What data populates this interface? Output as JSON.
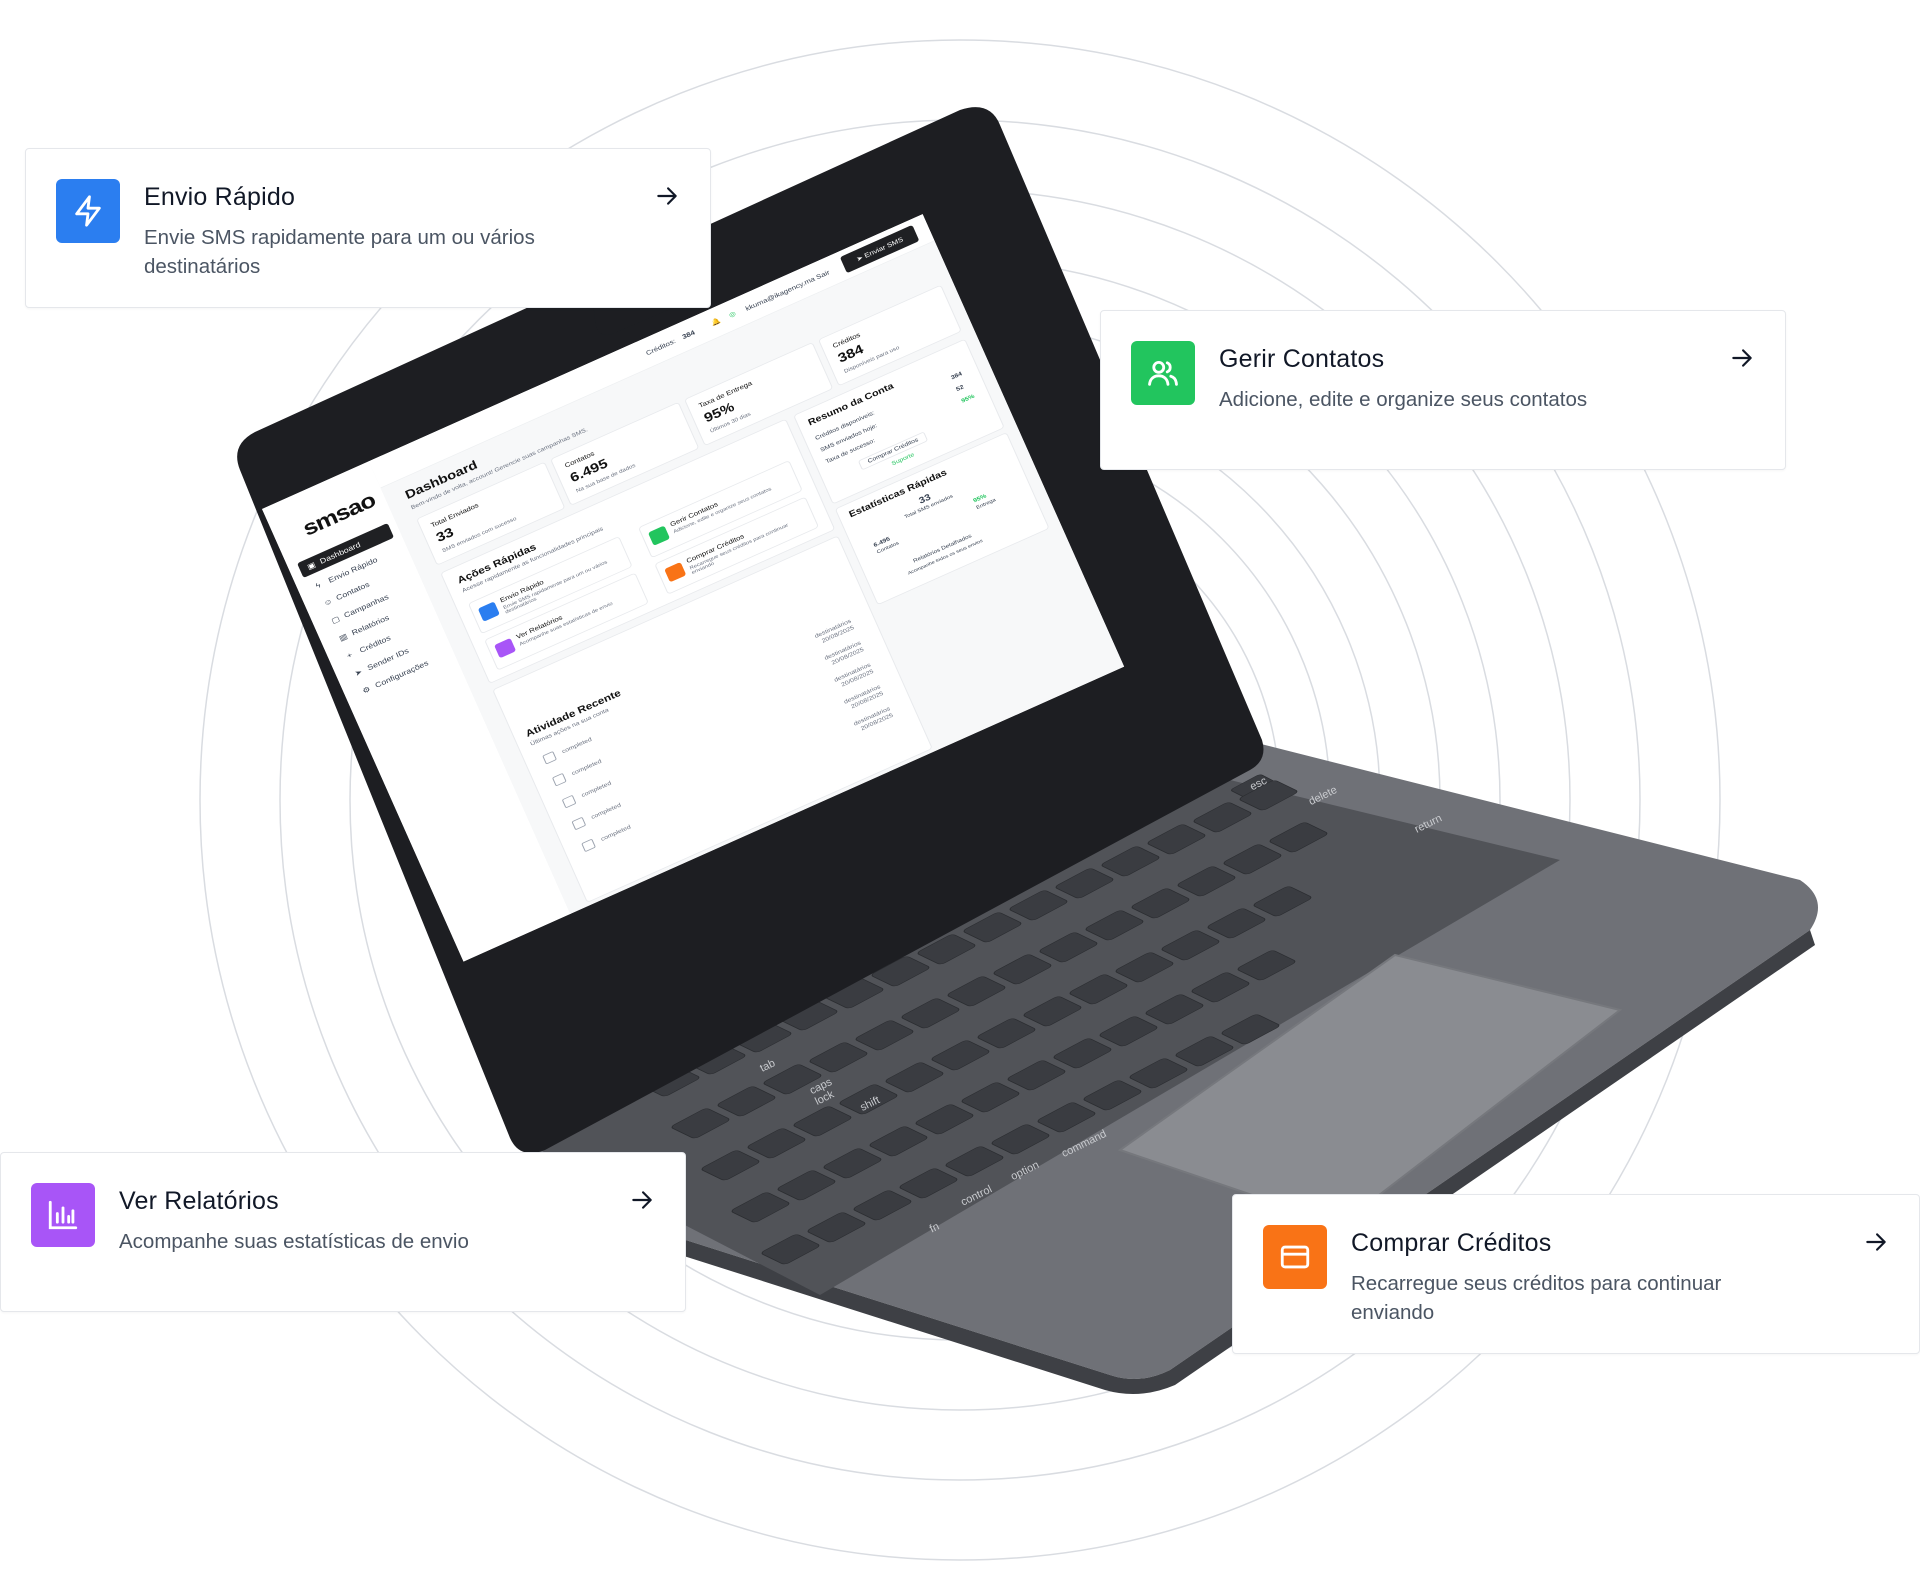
{
  "cards": {
    "envio_rapido": {
      "title": "Envio Rápido",
      "description": "Envie SMS rapidamente para um ou vários destinatários",
      "icon": "lightning-icon",
      "color": "#2b7ef0"
    },
    "gerir_contatos": {
      "title": "Gerir Contatos",
      "description": "Adicione, edite e organize seus contatos",
      "icon": "users-icon",
      "color": "#22c55e"
    },
    "ver_relatorios": {
      "title": "Ver Relatórios",
      "description": "Acompanhe suas estatísticas de envio",
      "icon": "bar-chart-icon",
      "color": "#a855f7"
    },
    "comprar_creditos": {
      "title": "Comprar Créditos",
      "description": "Recarregue seus créditos para continuar enviando",
      "icon": "credit-card-icon",
      "color": "#f97316"
    }
  },
  "dashboard": {
    "logo": "smsao",
    "header": {
      "credits_label": "Créditos:",
      "credits_value": "384",
      "user_email": "kkuma@ikagency.ma",
      "logout": "Sair",
      "send_button": "Enviar SMS"
    },
    "sidebar": [
      {
        "label": "Dashboard",
        "icon": "layout-icon"
      },
      {
        "label": "Envio Rápido",
        "icon": "lightning-icon"
      },
      {
        "label": "Contatos",
        "icon": "users-icon"
      },
      {
        "label": "Campanhas",
        "icon": "calendar-icon"
      },
      {
        "label": "Relatórios",
        "icon": "bar-chart-icon"
      },
      {
        "label": "Créditos",
        "icon": "plus-icon"
      },
      {
        "label": "Sender IDs",
        "icon": "send-icon"
      },
      {
        "label": "Configurações",
        "icon": "gear-icon"
      }
    ],
    "page_title": "Dashboard",
    "page_subtitle": "Bem-vindo de volta, account! Gerencie suas campanhas SMS.",
    "stats": [
      {
        "label": "Total Enviados",
        "value": "33",
        "sub": "SMS enviados com sucesso"
      },
      {
        "label": "Contatos",
        "value": "6.495",
        "sub": "Na sua base de dados"
      },
      {
        "label": "Taxa de Entrega",
        "value": "95%",
        "sub": "Últimos 30 dias"
      },
      {
        "label": "Créditos",
        "value": "384",
        "sub": "Disponíveis para uso"
      }
    ],
    "quick_actions": {
      "title": "Ações Rápidas",
      "subtitle": "Acesse rapidamente as funcionalidades principais",
      "items": [
        {
          "title": "Envio Rápido",
          "desc": "Envie SMS rapidamente para um ou vários destinatários"
        },
        {
          "title": "Gerir Contatos",
          "desc": "Adicione, edite e organize seus contatos"
        },
        {
          "title": "Ver Relatórios",
          "desc": "Acompanhe suas estatísticas de envio"
        },
        {
          "title": "Comprar Créditos",
          "desc": "Recarregue seus créditos para continuar enviando"
        }
      ]
    },
    "account_summary": {
      "title": "Resumo da Conta",
      "rows": [
        {
          "label": "Créditos disponíveis:",
          "value": "384"
        },
        {
          "label": "SMS enviados hoje:",
          "value": "52"
        },
        {
          "label": "Taxa de sucesso:",
          "value": "95%"
        }
      ],
      "buy_button": "Comprar Créditos",
      "support_link": "Suporte"
    },
    "quick_stats": {
      "title": "Estatísticas Rápidas",
      "total_value": "33",
      "total_label": "Total SMS enviados",
      "contacts_value": "6.495",
      "contacts_label": "Contatos",
      "delivery_value": "95%",
      "delivery_label": "Entrega",
      "report_title": "Relatórios Detalhados",
      "report_desc": "Acompanhe todos os seus envios"
    },
    "recent_activity": {
      "title": "Atividade Recente",
      "subtitle": "Últimas ações na sua conta",
      "items": [
        {
          "status": "completed",
          "who": "destinatários",
          "date": "20/08/2025"
        },
        {
          "status": "completed",
          "who": "destinatários",
          "date": "20/08/2025"
        },
        {
          "status": "completed",
          "who": "destinatários",
          "date": "20/08/2025"
        },
        {
          "status": "completed",
          "who": "destinatários",
          "date": "20/08/2025"
        },
        {
          "status": "completed",
          "who": "destinatários",
          "date": "20/08/2025"
        }
      ]
    }
  },
  "keyboard_labels": [
    "esc",
    "delete",
    "return",
    "shift",
    "tab",
    "caps lock",
    "control",
    "option",
    "command",
    "fn"
  ]
}
